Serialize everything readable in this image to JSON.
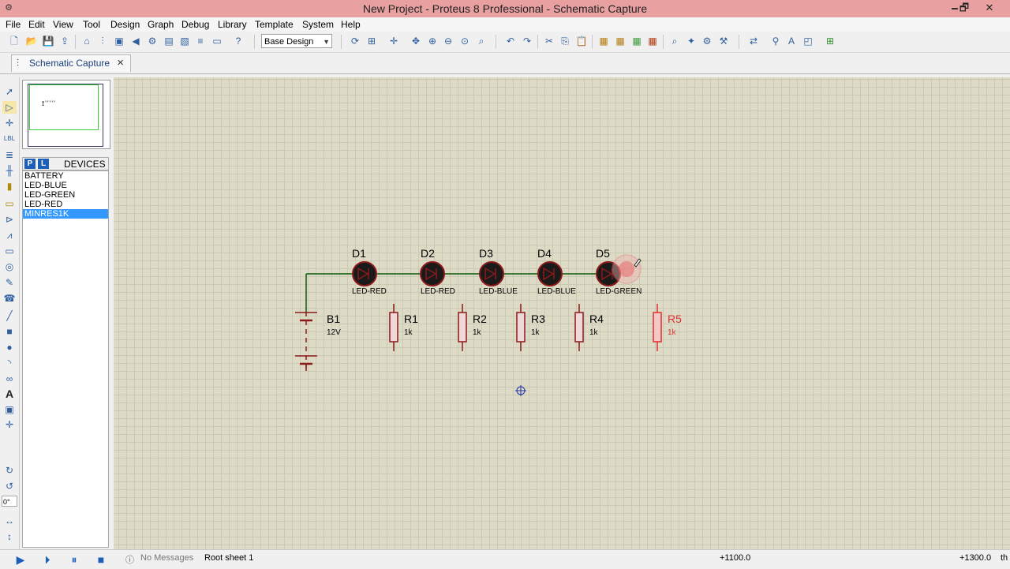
{
  "window": {
    "title": "New Project - Proteus 8 Professional - Schematic Capture",
    "minimize": "🗕",
    "restore": "🗗",
    "close": "✕"
  },
  "menu": [
    "File",
    "Edit",
    "View",
    "Tool",
    "Design",
    "Graph",
    "Debug",
    "Library",
    "Template",
    "System",
    "Help"
  ],
  "toolbar": {
    "design_select": "Base Design"
  },
  "tab": {
    "label": "Schematic Capture"
  },
  "devices": {
    "header": "DEVICES",
    "p_button": "P",
    "l_button": "L",
    "items": [
      "BATTERY",
      "LED-BLUE",
      "LED-GREEN",
      "LED-RED",
      "MINRES1K"
    ],
    "selected": "MINRES1K"
  },
  "rotation": {
    "value": "0°"
  },
  "schematic": {
    "leds": [
      {
        "ref": "D1",
        "type": "LED-RED"
      },
      {
        "ref": "D2",
        "type": "LED-RED"
      },
      {
        "ref": "D3",
        "type": "LED-BLUE"
      },
      {
        "ref": "D4",
        "type": "LED-BLUE"
      },
      {
        "ref": "D5",
        "type": "LED-GREEN"
      }
    ],
    "battery": {
      "ref": "B1",
      "value": "12V"
    },
    "resistors": [
      {
        "ref": "R1",
        "value": "1k"
      },
      {
        "ref": "R2",
        "value": "1k"
      },
      {
        "ref": "R3",
        "value": "1k"
      },
      {
        "ref": "R4",
        "value": "1k"
      },
      {
        "ref": "R5",
        "value": "1k",
        "ghost": true
      }
    ],
    "colors": {
      "wire": "#0b5a0b",
      "component": "#8b1a1a",
      "ghost": "#e03030",
      "text": "#000000"
    }
  },
  "status": {
    "messages": "No Messages",
    "sheet": "Root sheet 1",
    "coord_x": "+1100.0",
    "coord_y": "+1300.0",
    "units": "th"
  }
}
